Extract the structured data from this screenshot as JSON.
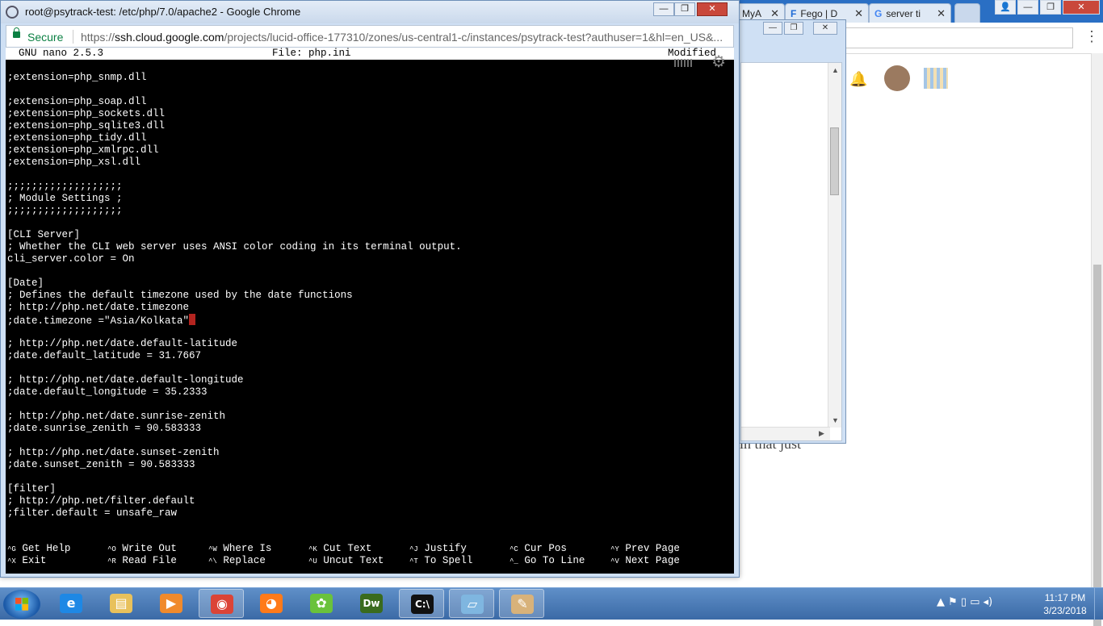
{
  "background_browser": {
    "tabs": [
      {
        "label": "MyA",
        "icon": "globe-icon"
      },
      {
        "label": "Fego | D",
        "icon": "fego-icon"
      },
      {
        "label": "server ti",
        "icon": "google-icon"
      }
    ],
    "page_text": "in that just"
  },
  "window": {
    "title": "root@psytrack-test: /etc/php/7.0/apache2 - Google Chrome",
    "secure_label": "Secure",
    "url_scheme": "https://",
    "url_host": "ssh.cloud.google.com",
    "url_path": "/projects/lucid-office-177310/zones/us-central1-c/instances/psytrack-test?authuser=1&hl=en_US&..."
  },
  "nano": {
    "version": "GNU nano 2.5.3",
    "file": "File: php.ini",
    "state": "Modified",
    "lines": [
      ";extension=php_snmp.dll",
      "",
      ";extension=php_soap.dll",
      ";extension=php_sockets.dll",
      ";extension=php_sqlite3.dll",
      ";extension=php_tidy.dll",
      ";extension=php_xmlrpc.dll",
      ";extension=php_xsl.dll",
      "",
      ";;;;;;;;;;;;;;;;;;;",
      "; Module Settings ;",
      ";;;;;;;;;;;;;;;;;;;",
      "",
      "[CLI Server]",
      "; Whether the CLI web server uses ANSI color coding in its terminal output.",
      "cli_server.color = On",
      "",
      "[Date]",
      "; Defines the default timezone used by the date functions",
      "; http://php.net/date.timezone",
      ";date.timezone =\"Asia/Kolkata\"",
      "",
      "; http://php.net/date.default-latitude",
      ";date.default_latitude = 31.7667",
      "",
      "; http://php.net/date.default-longitude",
      ";date.default_longitude = 35.2333",
      "",
      "; http://php.net/date.sunrise-zenith",
      ";date.sunrise_zenith = 90.583333",
      "",
      "; http://php.net/date.sunset-zenith",
      ";date.sunset_zenith = 90.583333",
      "",
      "[filter]",
      "; http://php.net/filter.default",
      ";filter.default = unsafe_raw"
    ],
    "cursor_line": 20,
    "shortcuts": [
      [
        {
          "key": "^G",
          "label": "Get Help"
        },
        {
          "key": "^O",
          "label": "Write Out"
        },
        {
          "key": "^W",
          "label": "Where Is"
        },
        {
          "key": "^K",
          "label": "Cut Text"
        },
        {
          "key": "^J",
          "label": "Justify"
        },
        {
          "key": "^C",
          "label": "Cur Pos"
        },
        {
          "key": "^Y",
          "label": "Prev Page"
        }
      ],
      [
        {
          "key": "^X",
          "label": "Exit"
        },
        {
          "key": "^R",
          "label": "Read File"
        },
        {
          "key": "^\\",
          "label": "Replace"
        },
        {
          "key": "^U",
          "label": "Uncut Text"
        },
        {
          "key": "^T",
          "label": "To Spell"
        },
        {
          "key": "^_",
          "label": "Go To Line"
        },
        {
          "key": "^V",
          "label": "Next Page"
        }
      ]
    ]
  },
  "taskbar": {
    "apps": [
      {
        "name": "internet-explorer",
        "icon": "ie-icon",
        "glyph": "e",
        "color": "#1e88e5"
      },
      {
        "name": "file-explorer",
        "icon": "folder-icon",
        "glyph": "▤",
        "color": "#e8c15c"
      },
      {
        "name": "media-player",
        "icon": "media-player-icon",
        "glyph": "▶",
        "color": "#f08a2c"
      },
      {
        "name": "chrome",
        "icon": "chrome-icon",
        "glyph": "◉",
        "color": "#db4437",
        "active": true
      },
      {
        "name": "firefox",
        "icon": "firefox-icon",
        "glyph": "◕",
        "color": "#ff7a1a"
      },
      {
        "name": "green-app",
        "icon": "green-app-icon",
        "glyph": "✿",
        "color": "#6ac23b"
      },
      {
        "name": "dreamweaver",
        "icon": "dreamweaver-icon",
        "glyph": "Dw",
        "color": "#3a6b1e"
      },
      {
        "name": "command-prompt",
        "icon": "cmd-icon",
        "glyph": "C:\\",
        "color": "#111111",
        "active": true
      },
      {
        "name": "notes",
        "icon": "notes-icon",
        "glyph": "▱",
        "color": "#7fb6e0",
        "active": true
      },
      {
        "name": "paint",
        "icon": "paint-icon",
        "glyph": "✎",
        "color": "#d8b27a",
        "active": true
      }
    ],
    "tray": "▲  ⚑  ▯  ▭  ◂)",
    "time": "11:17 PM",
    "date": "3/23/2018"
  }
}
